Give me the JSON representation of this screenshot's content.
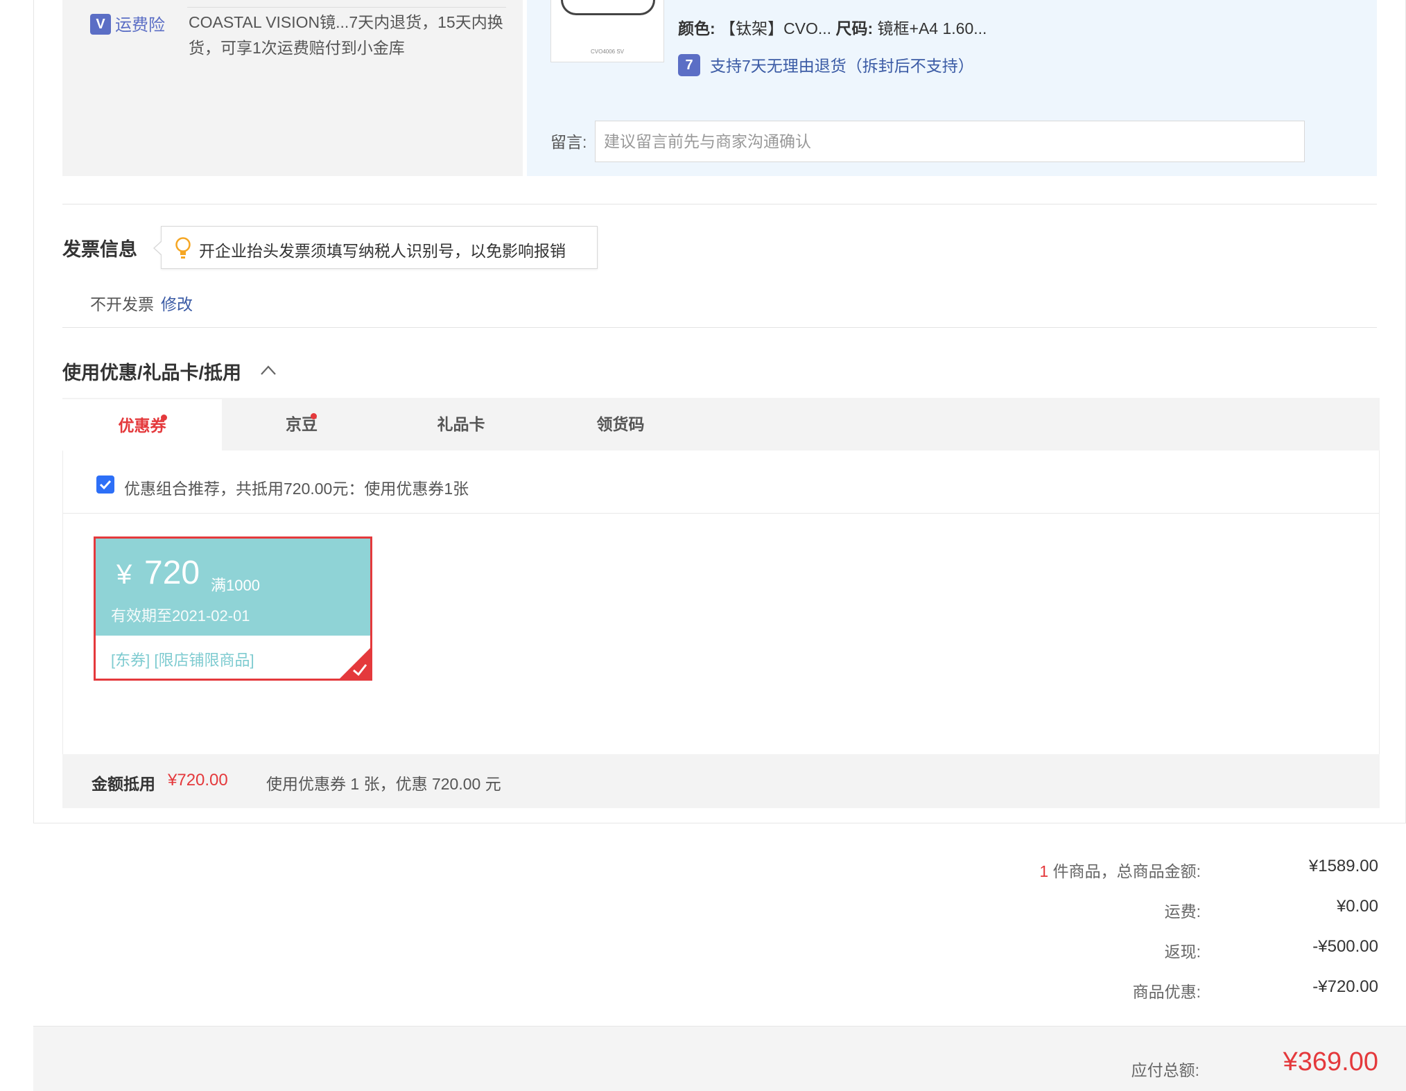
{
  "product": {
    "insurance_label": "运费险",
    "insurance_text": "COASTAL VISION镜...7天内退货，15天内换货，可享1次运费赔付到小金库",
    "thumb_code": "CVO4006 SV",
    "color_label": "颜色:",
    "color_value": "【钛架】CVO...",
    "size_label": "尺码:",
    "size_value": "镜框+A4 1.60...",
    "return_icon_text": "7",
    "return_text": "支持7天无理由退货（拆封后不支持）",
    "message_label": "留言:",
    "message_placeholder": "建议留言前先与商家沟通确认",
    "message_value": ""
  },
  "invoice": {
    "title": "发票信息",
    "tip": "开企业抬头发票须填写纳税人识别号，以免影响报销",
    "status": "不开发票",
    "edit": "修改"
  },
  "discount": {
    "title": "使用优惠/礼品卡/抵用",
    "tabs": [
      {
        "label": "优惠券",
        "active": true,
        "dot": true
      },
      {
        "label": "京豆",
        "active": false,
        "dot": true
      },
      {
        "label": "礼品卡",
        "active": false,
        "dot": false
      },
      {
        "label": "领货码",
        "active": false,
        "dot": false
      }
    ],
    "combo_checked": true,
    "combo_text": "优惠组合推荐，共抵用720.00元：使用优惠券1张",
    "coupon": {
      "yen": "¥",
      "amount": "720",
      "condition": "满1000",
      "validity": "有效期至2021-02-01",
      "tags": "[东券] [限店铺限商品]",
      "selected": true,
      "bg_color": "#8fd3d6"
    },
    "summary_label": "金额抵用",
    "summary_amount": "¥720.00",
    "summary_desc": "使用优惠券 1 张，优惠 720.00 元"
  },
  "totals": {
    "count": "1",
    "goods_label": "件商品，总商品金额:",
    "goods_value": "¥1589.00",
    "shipping_label": "运费:",
    "shipping_value": "¥0.00",
    "cashback_label": "返现:",
    "cashback_value": "-¥500.00",
    "promo_label": "商品优惠:",
    "promo_value": "-¥720.00",
    "pay_label": "应付总额:",
    "pay_value": "¥369.00"
  },
  "colors": {
    "accent_red": "#e4393c",
    "link_blue": "#3b5ba5",
    "badge_blue": "#5b6ec5",
    "coupon_teal": "#8fd3d6"
  }
}
